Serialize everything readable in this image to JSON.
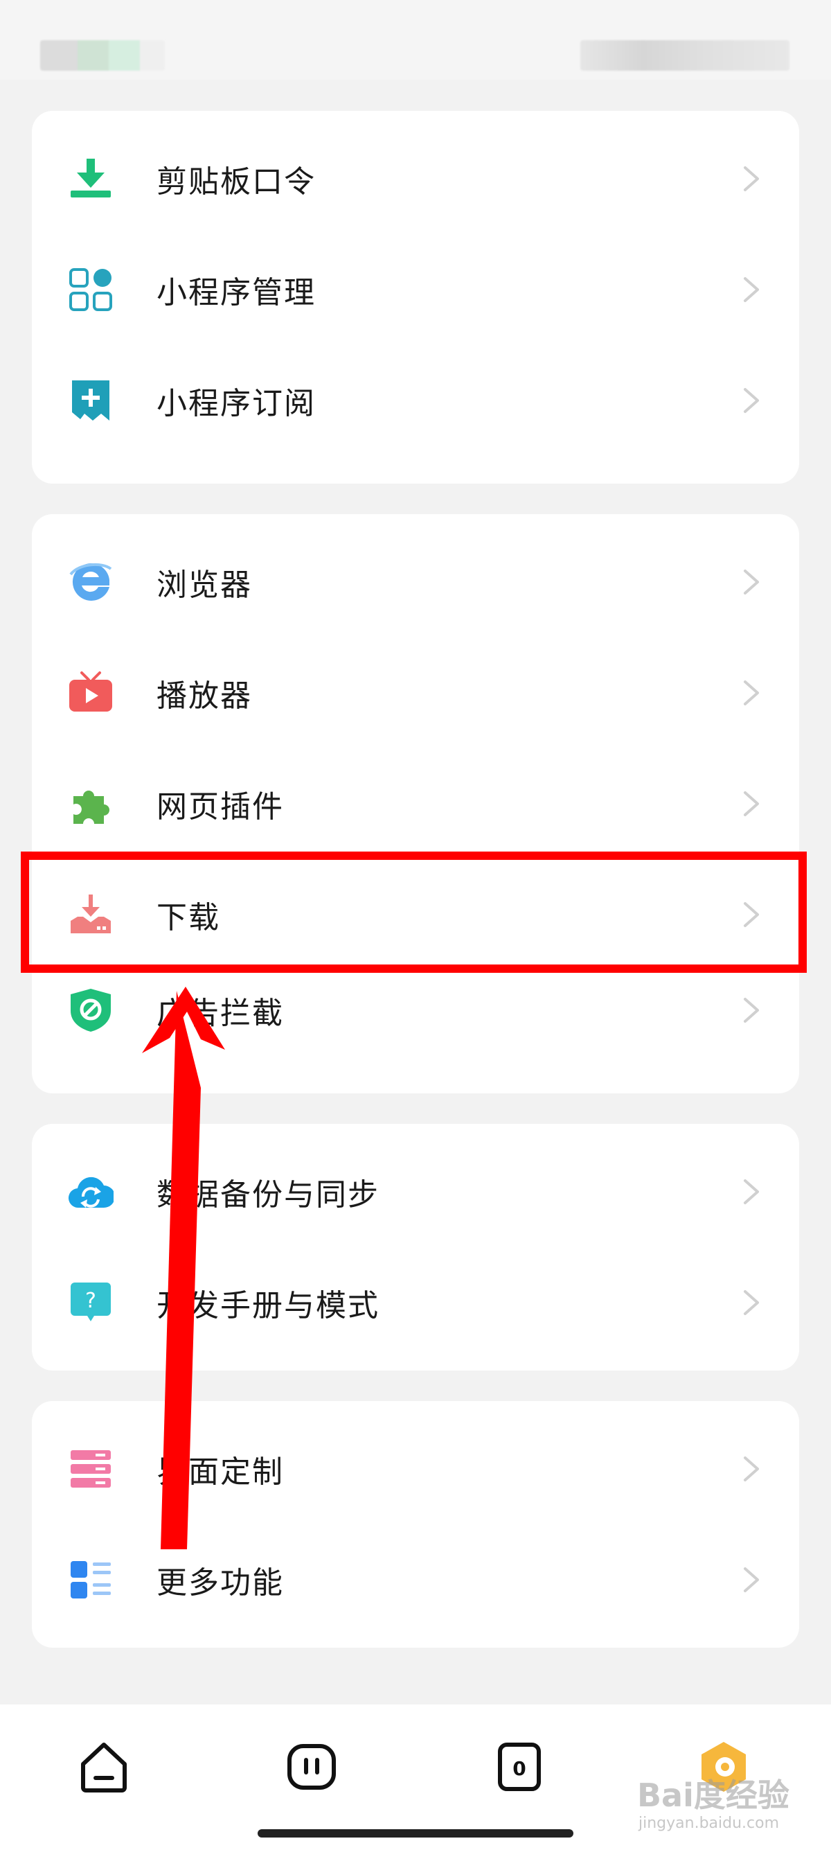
{
  "status_bar": {
    "left": "",
    "right": ""
  },
  "sections": [
    {
      "items": [
        {
          "label": "剪贴板口令",
          "icon": "clipboard-download-icon"
        },
        {
          "label": "小程序管理",
          "icon": "apps-grid-icon"
        },
        {
          "label": "小程序订阅",
          "icon": "bookmark-add-icon"
        }
      ]
    },
    {
      "items": [
        {
          "label": "浏览器",
          "icon": "browser-e-icon"
        },
        {
          "label": "播放器",
          "icon": "tv-player-icon"
        },
        {
          "label": "网页插件",
          "icon": "puzzle-plugin-icon"
        },
        {
          "label": "下载",
          "icon": "download-tray-icon"
        },
        {
          "label": "广告拦截",
          "icon": "ad-block-shield-icon"
        }
      ]
    },
    {
      "items": [
        {
          "label": "数据备份与同步",
          "icon": "cloud-sync-icon"
        },
        {
          "label": "开发手册与模式",
          "icon": "help-bubble-icon"
        }
      ]
    },
    {
      "items": [
        {
          "label": "界面定制",
          "icon": "layout-stack-icon"
        },
        {
          "label": "更多功能",
          "icon": "list-more-icon"
        }
      ]
    }
  ],
  "tabbar": {
    "tabs": [
      {
        "name": "home",
        "icon": "home-icon"
      },
      {
        "name": "tabs",
        "icon": "tabs-icon"
      },
      {
        "name": "count",
        "icon": "counter-icon",
        "badge": "0"
      },
      {
        "name": "profile",
        "icon": "hexagon-avatar-icon"
      }
    ]
  },
  "watermark": {
    "main": "Bai度经验",
    "sub": "jingyan.baidu.com"
  },
  "colors": {
    "highlight": "#ff0000",
    "accent_green": "#1fbf7a",
    "accent_teal": "#27a3bd",
    "arrow": "#ff0000"
  }
}
